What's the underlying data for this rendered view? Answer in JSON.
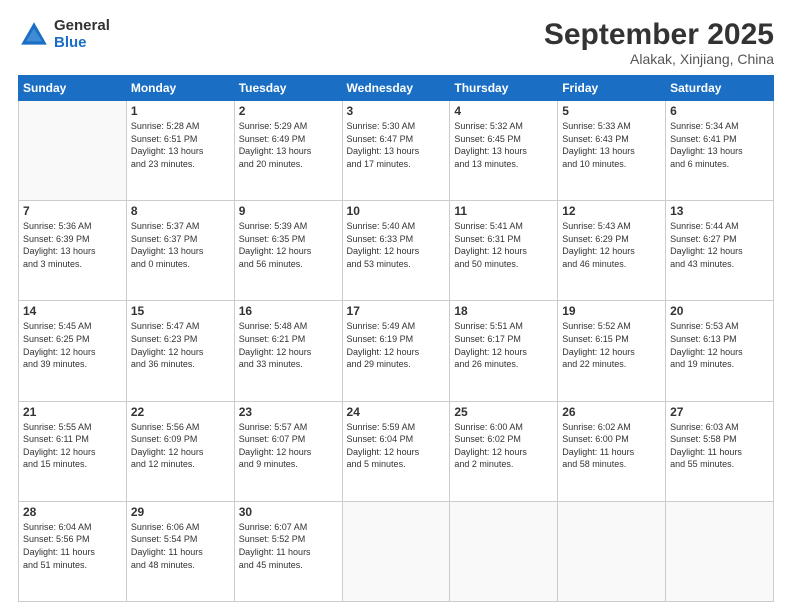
{
  "logo": {
    "general": "General",
    "blue": "Blue"
  },
  "header": {
    "month": "September 2025",
    "location": "Alakak, Xinjiang, China"
  },
  "weekdays": [
    "Sunday",
    "Monday",
    "Tuesday",
    "Wednesday",
    "Thursday",
    "Friday",
    "Saturday"
  ],
  "weeks": [
    [
      {
        "day": "",
        "info": ""
      },
      {
        "day": "1",
        "info": "Sunrise: 5:28 AM\nSunset: 6:51 PM\nDaylight: 13 hours\nand 23 minutes."
      },
      {
        "day": "2",
        "info": "Sunrise: 5:29 AM\nSunset: 6:49 PM\nDaylight: 13 hours\nand 20 minutes."
      },
      {
        "day": "3",
        "info": "Sunrise: 5:30 AM\nSunset: 6:47 PM\nDaylight: 13 hours\nand 17 minutes."
      },
      {
        "day": "4",
        "info": "Sunrise: 5:32 AM\nSunset: 6:45 PM\nDaylight: 13 hours\nand 13 minutes."
      },
      {
        "day": "5",
        "info": "Sunrise: 5:33 AM\nSunset: 6:43 PM\nDaylight: 13 hours\nand 10 minutes."
      },
      {
        "day": "6",
        "info": "Sunrise: 5:34 AM\nSunset: 6:41 PM\nDaylight: 13 hours\nand 6 minutes."
      }
    ],
    [
      {
        "day": "7",
        "info": "Sunrise: 5:36 AM\nSunset: 6:39 PM\nDaylight: 13 hours\nand 3 minutes."
      },
      {
        "day": "8",
        "info": "Sunrise: 5:37 AM\nSunset: 6:37 PM\nDaylight: 13 hours\nand 0 minutes."
      },
      {
        "day": "9",
        "info": "Sunrise: 5:39 AM\nSunset: 6:35 PM\nDaylight: 12 hours\nand 56 minutes."
      },
      {
        "day": "10",
        "info": "Sunrise: 5:40 AM\nSunset: 6:33 PM\nDaylight: 12 hours\nand 53 minutes."
      },
      {
        "day": "11",
        "info": "Sunrise: 5:41 AM\nSunset: 6:31 PM\nDaylight: 12 hours\nand 50 minutes."
      },
      {
        "day": "12",
        "info": "Sunrise: 5:43 AM\nSunset: 6:29 PM\nDaylight: 12 hours\nand 46 minutes."
      },
      {
        "day": "13",
        "info": "Sunrise: 5:44 AM\nSunset: 6:27 PM\nDaylight: 12 hours\nand 43 minutes."
      }
    ],
    [
      {
        "day": "14",
        "info": "Sunrise: 5:45 AM\nSunset: 6:25 PM\nDaylight: 12 hours\nand 39 minutes."
      },
      {
        "day": "15",
        "info": "Sunrise: 5:47 AM\nSunset: 6:23 PM\nDaylight: 12 hours\nand 36 minutes."
      },
      {
        "day": "16",
        "info": "Sunrise: 5:48 AM\nSunset: 6:21 PM\nDaylight: 12 hours\nand 33 minutes."
      },
      {
        "day": "17",
        "info": "Sunrise: 5:49 AM\nSunset: 6:19 PM\nDaylight: 12 hours\nand 29 minutes."
      },
      {
        "day": "18",
        "info": "Sunrise: 5:51 AM\nSunset: 6:17 PM\nDaylight: 12 hours\nand 26 minutes."
      },
      {
        "day": "19",
        "info": "Sunrise: 5:52 AM\nSunset: 6:15 PM\nDaylight: 12 hours\nand 22 minutes."
      },
      {
        "day": "20",
        "info": "Sunrise: 5:53 AM\nSunset: 6:13 PM\nDaylight: 12 hours\nand 19 minutes."
      }
    ],
    [
      {
        "day": "21",
        "info": "Sunrise: 5:55 AM\nSunset: 6:11 PM\nDaylight: 12 hours\nand 15 minutes."
      },
      {
        "day": "22",
        "info": "Sunrise: 5:56 AM\nSunset: 6:09 PM\nDaylight: 12 hours\nand 12 minutes."
      },
      {
        "day": "23",
        "info": "Sunrise: 5:57 AM\nSunset: 6:07 PM\nDaylight: 12 hours\nand 9 minutes."
      },
      {
        "day": "24",
        "info": "Sunrise: 5:59 AM\nSunset: 6:04 PM\nDaylight: 12 hours\nand 5 minutes."
      },
      {
        "day": "25",
        "info": "Sunrise: 6:00 AM\nSunset: 6:02 PM\nDaylight: 12 hours\nand 2 minutes."
      },
      {
        "day": "26",
        "info": "Sunrise: 6:02 AM\nSunset: 6:00 PM\nDaylight: 11 hours\nand 58 minutes."
      },
      {
        "day": "27",
        "info": "Sunrise: 6:03 AM\nSunset: 5:58 PM\nDaylight: 11 hours\nand 55 minutes."
      }
    ],
    [
      {
        "day": "28",
        "info": "Sunrise: 6:04 AM\nSunset: 5:56 PM\nDaylight: 11 hours\nand 51 minutes."
      },
      {
        "day": "29",
        "info": "Sunrise: 6:06 AM\nSunset: 5:54 PM\nDaylight: 11 hours\nand 48 minutes."
      },
      {
        "day": "30",
        "info": "Sunrise: 6:07 AM\nSunset: 5:52 PM\nDaylight: 11 hours\nand 45 minutes."
      },
      {
        "day": "",
        "info": ""
      },
      {
        "day": "",
        "info": ""
      },
      {
        "day": "",
        "info": ""
      },
      {
        "day": "",
        "info": ""
      }
    ]
  ]
}
